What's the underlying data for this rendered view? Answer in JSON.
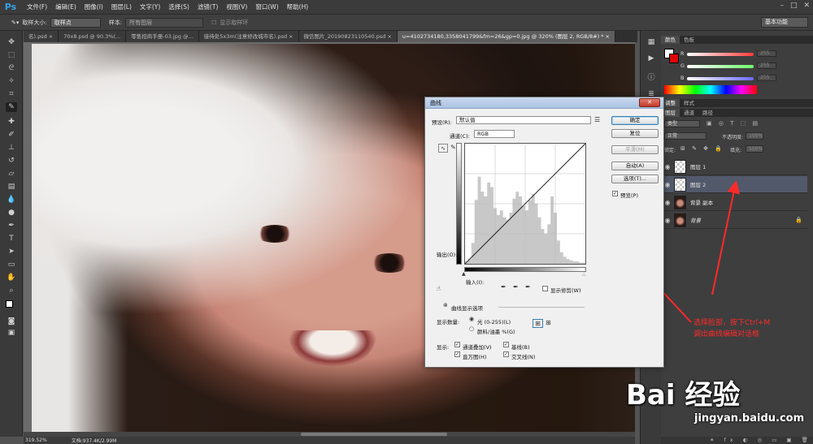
{
  "app": {
    "logo": "Ps"
  },
  "menubar": {
    "items": [
      "文件(F)",
      "编辑(E)",
      "图像(I)",
      "图层(L)",
      "文字(Y)",
      "选择(S)",
      "滤镜(T)",
      "视图(V)",
      "窗口(W)",
      "帮助(H)"
    ]
  },
  "options_bar": {
    "sample_size_label": "取样大小:",
    "sample_size_value": "取样点",
    "sample_label": "样本:",
    "sample_value": "所有图层",
    "show_ring_label": "显示取样环",
    "workspace": "基本功能"
  },
  "tabs": [
    {
      "label": "名).psd ×",
      "active": false
    },
    {
      "label": "70x8.psd @ 90.3%(...",
      "active": false
    },
    {
      "label": "零售招商手册-03.jpg @...",
      "active": false
    },
    {
      "label": "接待处5x3m(注意修改城市名).psd ×",
      "active": false
    },
    {
      "label": "微信图片_20190823110540.psd ×",
      "active": false
    },
    {
      "label": "u=4102734180,3358041799&fm=26&gp=0.jpg @ 320% (图层 2, RGB/8#) * ×",
      "active": true
    }
  ],
  "status": {
    "zoom": "319.52%",
    "doc": "文档:937.4K/2.99M"
  },
  "color_panel": {
    "tabs": [
      "颜色",
      "色板"
    ],
    "channels": [
      {
        "label": "R",
        "value": "255",
        "color": "#ff3a3a"
      },
      {
        "label": "G",
        "value": "255",
        "color": "#6cff6c"
      },
      {
        "label": "B",
        "value": "255",
        "color": "#6a6aff"
      }
    ]
  },
  "layers_panel": {
    "tabs": [
      "图层",
      "通道",
      "路径"
    ],
    "adjust_tabs": [
      "调整",
      "样式"
    ],
    "kind_filter": "类型",
    "blend_mode": "正常",
    "opacity_label": "不透明度:",
    "opacity_value": "100%",
    "lock_label": "锁定:",
    "fill_label": "填充:",
    "fill_value": "100%",
    "layers": [
      {
        "name": "图层 1",
        "thumb": "checker",
        "selected": false,
        "locked": false
      },
      {
        "name": "图层 2",
        "thumb": "checker",
        "selected": true,
        "locked": false
      },
      {
        "name": "背景 副本",
        "thumb": "face",
        "selected": false,
        "locked": false
      },
      {
        "name": "背景",
        "thumb": "face",
        "selected": false,
        "locked": true
      }
    ]
  },
  "annotation": {
    "line1": "选择脸部，按下Ctrl+M",
    "line2": "调出曲线编辑对话框",
    "color": "#ff2a2a"
  },
  "watermark": {
    "main": "Bai 经验",
    "sub": "jingyan.baidu.com"
  },
  "curves_dialog": {
    "title": "曲线",
    "preset_label": "预设(R):",
    "preset_value": "默认值",
    "channel_label": "通道(C):",
    "channel_value": "RGB",
    "output_label": "输出(O):",
    "input_label": "输入(I):",
    "show_clipping_label": "显示修剪(W)",
    "display_options_label": "曲线显示选项",
    "show_amount_label": "显示数量:",
    "light_option": "光 (0-255)(L)",
    "pigment_option": "颜料/油墨 %(G)",
    "show_label": "显示:",
    "checks": [
      {
        "label": "通道叠加(V)",
        "checked": true
      },
      {
        "label": "基线(B)",
        "checked": true
      },
      {
        "label": "直方图(H)",
        "checked": true
      },
      {
        "label": "交叉线(N)",
        "checked": true
      }
    ],
    "buttons": {
      "ok": "确定",
      "reset": "复位",
      "smooth": "平滑(M)",
      "auto": "自动(A)",
      "options": "选项(T)...",
      "preview": "预览(P)"
    },
    "histogram": [
      2,
      4,
      18,
      55,
      75,
      62,
      58,
      70,
      66,
      48,
      42,
      46,
      40,
      38,
      44,
      56,
      62,
      58,
      50,
      46,
      55,
      60,
      52,
      40,
      30,
      26,
      34,
      58,
      44,
      20,
      10,
      6,
      4,
      3,
      2,
      2,
      1,
      1
    ]
  }
}
